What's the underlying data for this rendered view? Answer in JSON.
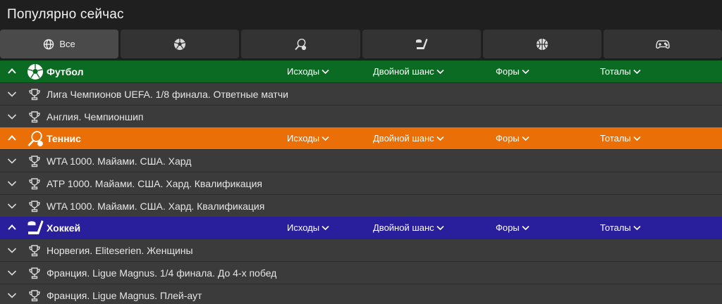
{
  "header": {
    "title": "Популярно сейчас"
  },
  "tabs": [
    {
      "label": "Все",
      "icon": "globe-icon",
      "active": true
    },
    {
      "label": "",
      "icon": "soccer-ball-icon"
    },
    {
      "label": "",
      "icon": "tennis-icon"
    },
    {
      "label": "",
      "icon": "hockey-icon"
    },
    {
      "label": "",
      "icon": "basketball-icon"
    },
    {
      "label": "",
      "icon": "gamepad-icon"
    }
  ],
  "markets": {
    "outcomes": "Исходы",
    "double_chance": "Двойной шанс",
    "handicaps": "Форы",
    "totals": "Тоталы"
  },
  "sections": [
    {
      "name": "Футбол",
      "color": "#0c6b23",
      "icon": "soccer-ball-icon",
      "leagues": [
        "Лига Чемпионов UEFA. 1/8 финала. Ответные матчи",
        "Англия. Чемпионшип"
      ]
    },
    {
      "name": "Теннис",
      "color": "#e96f06",
      "icon": "tennis-icon",
      "leagues": [
        "WTA 1000. Майами. США. Хард",
        "ATP 1000. Майами. США. Хард. Квалификация",
        "WTA 1000. Майами. США. Хард. Квалификация"
      ]
    },
    {
      "name": "Хоккей",
      "color": "#291e9c",
      "icon": "hockey-icon",
      "leagues": [
        "Норвегия. Eliteserien. Женщины",
        "Франция. Ligue Magnus. 1/4 финала. До 4-х побед",
        "Франция. Ligue Magnus. Плей-аут"
      ]
    }
  ]
}
